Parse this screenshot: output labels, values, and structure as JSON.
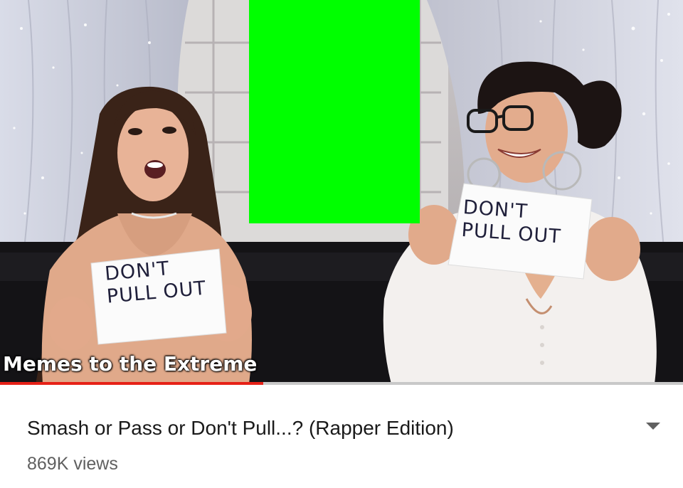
{
  "video": {
    "watermark": "Memes to the Extreme",
    "sign_left_text": "DON'T\nPULL OUT",
    "sign_right_text": "DON'T\nPULL OUT",
    "progress": 0.385,
    "overlay_color": "#00ff00",
    "progress_color": "#e62117"
  },
  "info": {
    "title": "Smash or Pass or Don't Pull...? (Rapper Edition)",
    "views": "869K views",
    "expand_icon": "chevron-down-icon"
  }
}
